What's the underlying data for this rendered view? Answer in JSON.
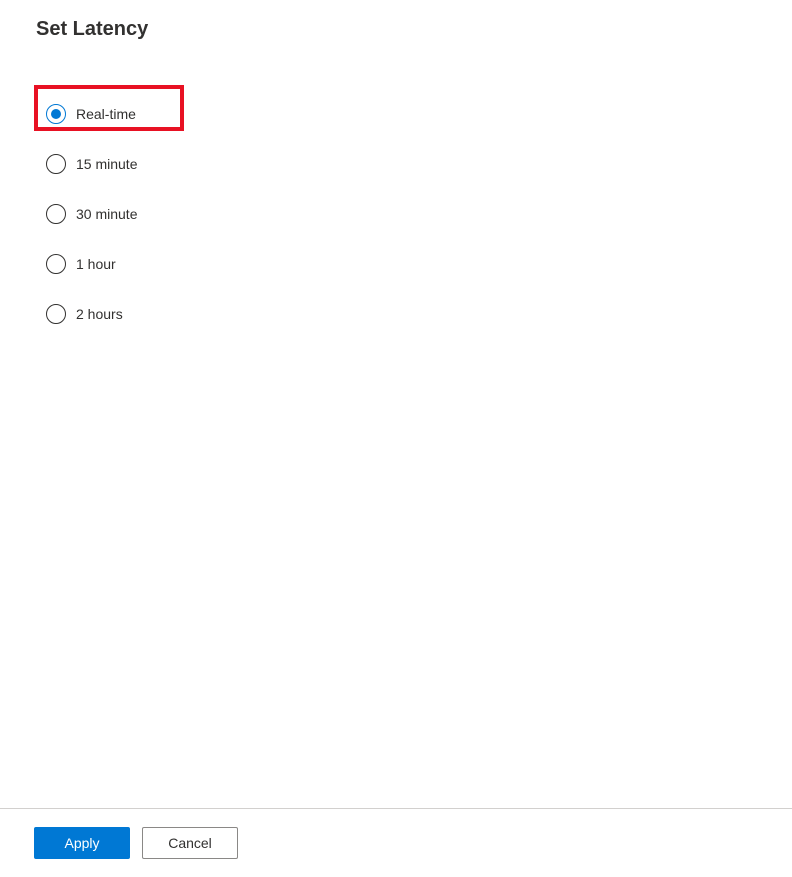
{
  "panel": {
    "title": "Set Latency",
    "options": [
      {
        "label": "Real-time",
        "selected": true,
        "highlighted": true
      },
      {
        "label": "15 minute",
        "selected": false,
        "highlighted": false
      },
      {
        "label": "30 minute",
        "selected": false,
        "highlighted": false
      },
      {
        "label": "1 hour",
        "selected": false,
        "highlighted": false
      },
      {
        "label": "2 hours",
        "selected": false,
        "highlighted": false
      }
    ],
    "footer": {
      "apply_label": "Apply",
      "cancel_label": "Cancel"
    }
  },
  "colors": {
    "accent": "#0078d4",
    "highlight_border": "#e81123",
    "text": "#323130",
    "divider": "#d2d0ce"
  }
}
